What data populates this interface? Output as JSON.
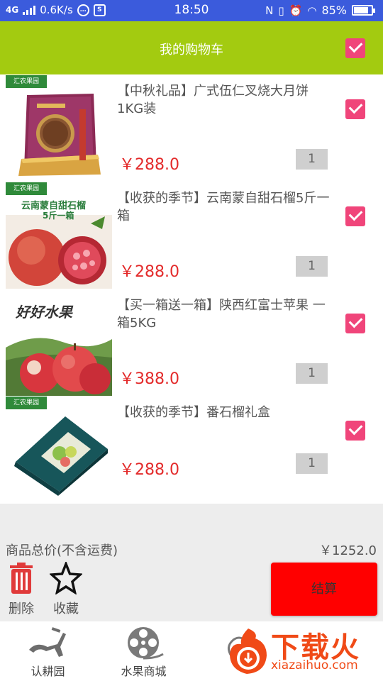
{
  "status_bar": {
    "network": "4G",
    "speed": "0.6K/s",
    "time": "18:50",
    "battery": "85%",
    "battery_level": 0.85
  },
  "header": {
    "title": "我的购物车",
    "select_all_checked": true
  },
  "cart": {
    "items": [
      {
        "title": "【中秋礼品】广式伍仁叉烧大月饼  1KG装",
        "price": "￥288.0",
        "quantity": "1",
        "checked": true
      },
      {
        "title": "【收获的季节】云南蒙自甜石榴5斤一箱",
        "price": "￥288.0",
        "quantity": "1",
        "checked": true
      },
      {
        "title": "【买一箱送一箱】陕西红富士苹果 一箱5KG",
        "price": "￥388.0",
        "quantity": "1",
        "checked": true
      },
      {
        "title": "【收获的季节】番石榴礼盒",
        "price": "￥288.0",
        "quantity": "1",
        "checked": true
      }
    ]
  },
  "thumbs": {
    "brand": "汇农果园",
    "pomegranate_text": "云南蒙自甜石榴",
    "pomegranate_sub": "5斤一箱",
    "apple_text": "好好水果"
  },
  "footer": {
    "total_label": "商品总价(不含运费)",
    "total_value": "￥1252.0",
    "delete_label": "删除",
    "favorite_label": "收藏",
    "checkout_label": "结算"
  },
  "nav": {
    "items": [
      {
        "label": "认耕园",
        "icon": "plough-icon"
      },
      {
        "label": "水果商城",
        "icon": "film-reel-icon"
      },
      {
        "label": "",
        "icon": "fruit-icon"
      },
      {
        "label": "",
        "icon": "profile-icon"
      }
    ]
  },
  "watermark": {
    "cn": "下载火",
    "en": "xiazaihuo.com"
  },
  "colors": {
    "status_bar": "#3b5bdc",
    "header": "#a3cb10",
    "checkbox": "#f0457a",
    "price": "#e32a2a",
    "checkout": "#ff0000",
    "watermark": "#f04a17"
  }
}
